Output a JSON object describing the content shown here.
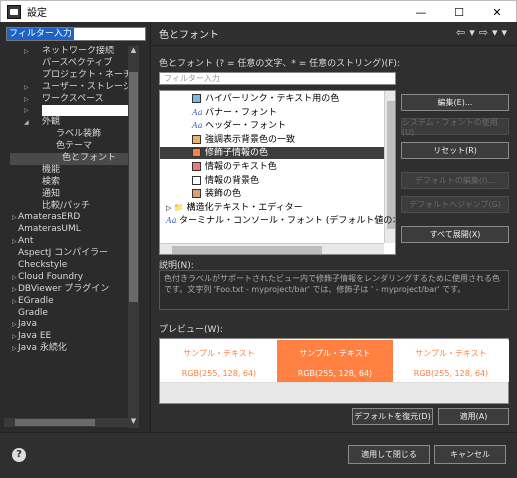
{
  "window": {
    "title": "設定",
    "min": "—",
    "max": "☐",
    "close": "✕"
  },
  "filter": {
    "value": "フィルター入力"
  },
  "tree": [
    {
      "label": "ネットワーク接続",
      "indent": 2,
      "arrow": "▷"
    },
    {
      "label": "パースペクティブ",
      "indent": 2,
      "arrow": ""
    },
    {
      "label": "プロジェクト・ネーチャー",
      "indent": 2,
      "arrow": ""
    },
    {
      "label": "ユーザー・ストレージ・サ",
      "indent": 2,
      "arrow": "▷"
    },
    {
      "label": "ワークスペース",
      "indent": 2,
      "arrow": "▷"
    },
    {
      "label": "",
      "indent": 2,
      "arrow": "▷",
      "blank": true
    },
    {
      "label": "外観",
      "indent": 2,
      "arrow": "◢"
    },
    {
      "label": "ラベル装飾",
      "indent": 3,
      "arrow": ""
    },
    {
      "label": "色テーマ",
      "indent": 3,
      "arrow": ""
    },
    {
      "label": "色とフォント",
      "indent": 3,
      "arrow": "",
      "selected": true
    },
    {
      "label": "機能",
      "indent": 2,
      "arrow": ""
    },
    {
      "label": "検索",
      "indent": 2,
      "arrow": ""
    },
    {
      "label": "通知",
      "indent": 2,
      "arrow": ""
    },
    {
      "label": "比較/パッチ",
      "indent": 2,
      "arrow": ""
    },
    {
      "label": "AmaterasERD",
      "indent": 0,
      "arrow": "▷"
    },
    {
      "label": "AmaterasUML",
      "indent": 0,
      "arrow": ""
    },
    {
      "label": "Ant",
      "indent": 0,
      "arrow": "▷"
    },
    {
      "label": "AspectJ コンパイラー",
      "indent": 0,
      "arrow": ""
    },
    {
      "label": "Checkstyle",
      "indent": 0,
      "arrow": ""
    },
    {
      "label": "Cloud Foundry",
      "indent": 0,
      "arrow": "▷"
    },
    {
      "label": "DBViewer プラグイン",
      "indent": 0,
      "arrow": "▷"
    },
    {
      "label": "EGradle",
      "indent": 0,
      "arrow": "▷"
    },
    {
      "label": "Gradle",
      "indent": 0,
      "arrow": ""
    },
    {
      "label": "Java",
      "indent": 0,
      "arrow": "▷"
    },
    {
      "label": "Java EE",
      "indent": 0,
      "arrow": "▷"
    },
    {
      "label": "Java 永続化",
      "indent": 0,
      "arrow": "▷"
    }
  ],
  "page": {
    "title": "色とフォント",
    "nav_back": "⇦",
    "nav_fwd": "⇨",
    "nav_menu": "▾",
    "list_label": "色とフォント (? = 任意の文字、* = 任意のストリング)(F):",
    "search_placeholder": "フィルター入力",
    "items": [
      {
        "kind": "color",
        "color": "#7fb4e6",
        "label": "ハイパーリンク・テキスト用の色",
        "indent": 1
      },
      {
        "kind": "font",
        "label": "バナー・フォント",
        "indent": 1
      },
      {
        "kind": "font",
        "label": "ヘッダー・フォント",
        "indent": 1
      },
      {
        "kind": "color",
        "color": "#e9b26d",
        "label": "強調表示背景色の一致",
        "indent": 1
      },
      {
        "kind": "color",
        "color": "#ff8040",
        "label": "修飾子情報の色",
        "indent": 1,
        "selected": true
      },
      {
        "kind": "color",
        "color": "#ef7777",
        "label": "情報のテキスト色",
        "indent": 1
      },
      {
        "kind": "color",
        "color": "#ffffff",
        "label": "情報の背景色",
        "indent": 1
      },
      {
        "kind": "color",
        "color": "#d7a469",
        "label": "装飾の色",
        "indent": 1
      },
      {
        "kind": "folder",
        "label": "構造化テキスト・エディター",
        "indent": 0
      },
      {
        "kind": "font",
        "label": "ターミナル・コンソール・フォント (デフォルト値のオー",
        "indent": 0
      }
    ],
    "buttons": {
      "edit": "編集(E)...",
      "system_font": "システム・フォントの使用(U)",
      "reset": "リセット(R)",
      "edit_default": "デフォルトの編集(I)...",
      "goto_default": "デフォルトへジャンプ(G)",
      "expand_all": "すべて展開(X)"
    },
    "desc_label": "説明(N):",
    "description": "色付きラベルがサポートされたビュー内で修飾子情報をレンダリングするために使用される色です。文字列 'Foo.txt - myproject/bar' では、修飾子は ' - myproject/bar' です。",
    "preview_label": "プレビュー(W):",
    "preview": [
      {
        "text": "サンプル・テキスト",
        "rgb": "RGB(255, 128, 64)",
        "bg": "#ffffff",
        "fg": "#ff8040"
      },
      {
        "text": "サンプル・テキスト",
        "rgb": "RGB(255, 128, 64)",
        "bg": "#ff8040",
        "fg": "#ffffff"
      },
      {
        "text": "サンプル・テキスト",
        "rgb": "RGB(255, 128, 64)",
        "bg": "#ffffff",
        "fg": "#ff8040"
      }
    ],
    "restore_default": "デフォルトを復元(D)",
    "apply": "適用(A)"
  },
  "footer": {
    "help": "?",
    "apply_close": "適用して閉じる",
    "cancel": "キャンセル"
  }
}
